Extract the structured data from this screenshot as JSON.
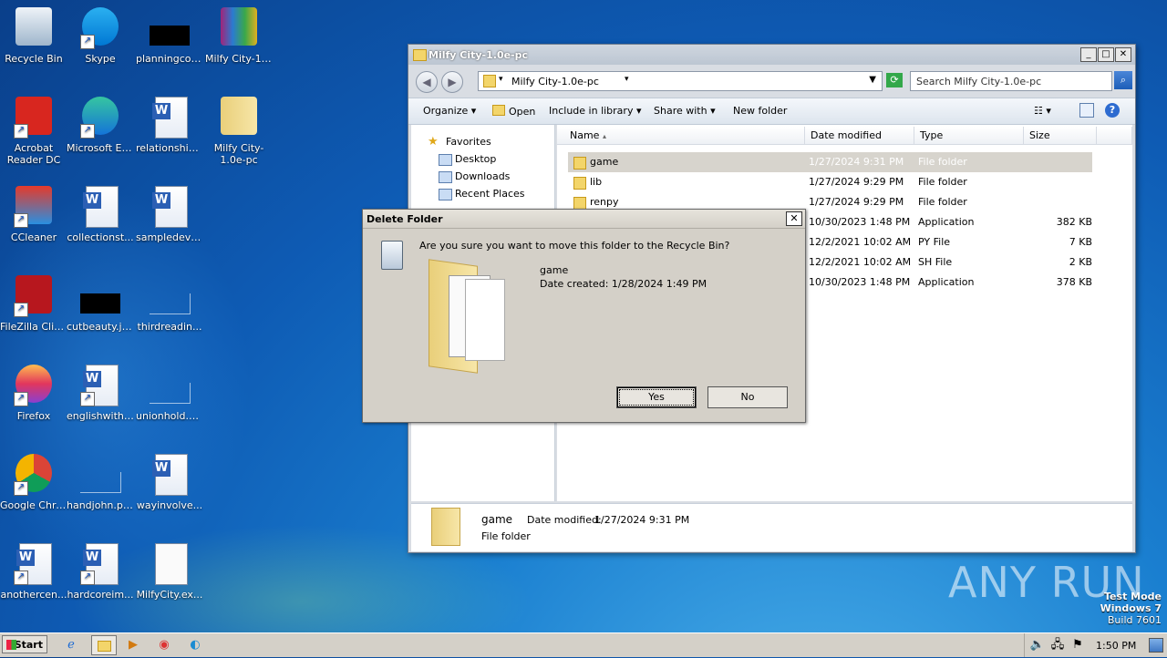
{
  "desktop": {
    "icons": [
      {
        "label": "Recycle Bin",
        "icon": "recycle-bin-icon"
      },
      {
        "label": "Skype",
        "icon": "skype-icon"
      },
      {
        "label": "planningcoff...",
        "icon": "image-file-icon"
      },
      {
        "label": "Milfy City-1.0e-p...",
        "icon": "winrar-archive-icon"
      },
      {
        "label": "Acrobat Reader DC",
        "icon": "acrobat-icon"
      },
      {
        "label": "Microsoft Edge",
        "icon": "edge-icon"
      },
      {
        "label": "relationship...",
        "icon": "word-doc-icon"
      },
      {
        "label": "Milfy City-1.0e-pc",
        "icon": "folder-icon"
      },
      {
        "label": "CCleaner",
        "icon": "ccleaner-icon"
      },
      {
        "label": "collectionst...",
        "icon": "word-doc-icon"
      },
      {
        "label": "sampledevel...",
        "icon": "word-doc-icon"
      },
      {
        "label": "FileZilla Client",
        "icon": "filezilla-icon"
      },
      {
        "label": "cutbeauty.jpg",
        "icon": "image-file-icon"
      },
      {
        "label": "thirdreadin...",
        "icon": "image-file-icon"
      },
      {
        "label": "Firefox",
        "icon": "firefox-icon"
      },
      {
        "label": "englishwithi...",
        "icon": "word-doc-icon"
      },
      {
        "label": "unionhold.png",
        "icon": "image-file-icon"
      },
      {
        "label": "Google Chrome",
        "icon": "chrome-icon"
      },
      {
        "label": "handjohn.png",
        "icon": "image-file-icon"
      },
      {
        "label": "wayinvolve...",
        "icon": "word-doc-icon"
      },
      {
        "label": "anothercen...",
        "icon": "word-doc-icon"
      },
      {
        "label": "hardcoreim...",
        "icon": "word-doc-icon"
      },
      {
        "label": "MilfyCity.ex...",
        "icon": "text-file-icon"
      }
    ]
  },
  "explorer": {
    "title": "Milfy City-1.0e-pc",
    "address": "Milfy City-1.0e-pc",
    "search_placeholder": "Search Milfy City-1.0e-pc",
    "toolbar": {
      "organize": "Organize",
      "open": "Open",
      "include": "Include in library",
      "share": "Share with",
      "new_folder": "New folder"
    },
    "nav": {
      "favorites": "Favorites",
      "desktop": "Desktop",
      "downloads": "Downloads",
      "recent": "Recent Places"
    },
    "columns": {
      "name": "Name",
      "date": "Date modified",
      "type": "Type",
      "size": "Size"
    },
    "files": [
      {
        "name": "game",
        "date": "1/27/2024 9:31 PM",
        "type": "File folder",
        "size": ""
      },
      {
        "name": "lib",
        "date": "1/27/2024 9:29 PM",
        "type": "File folder",
        "size": ""
      },
      {
        "name": "renpy",
        "date": "1/27/2024 9:29 PM",
        "type": "File folder",
        "size": ""
      },
      {
        "name": "",
        "date": "10/30/2023 1:48 PM",
        "type": "Application",
        "size": "382 KB"
      },
      {
        "name": "",
        "date": "12/2/2021 10:02 AM",
        "type": "PY File",
        "size": "7 KB"
      },
      {
        "name": "",
        "date": "12/2/2021 10:02 AM",
        "type": "SH File",
        "size": "2 KB"
      },
      {
        "name": "",
        "date": "10/30/2023 1:48 PM",
        "type": "Application",
        "size": "378 KB"
      }
    ],
    "details": {
      "name": "game",
      "date_label": "Date modified:",
      "date": "1/27/2024 9:31 PM",
      "type": "File folder"
    }
  },
  "dialog": {
    "title": "Delete Folder",
    "question": "Are you sure you want to move this folder to the Recycle Bin?",
    "item_name": "game",
    "date_created": "Date created: 1/28/2024 1:49 PM",
    "yes": "Yes",
    "no": "No"
  },
  "taskbar": {
    "start": "Start",
    "clock": "1:50 PM"
  },
  "watermark": "ANY RUN",
  "testmode": {
    "line1": "Test Mode",
    "line2": "Windows 7",
    "line3": "Build 7601"
  }
}
